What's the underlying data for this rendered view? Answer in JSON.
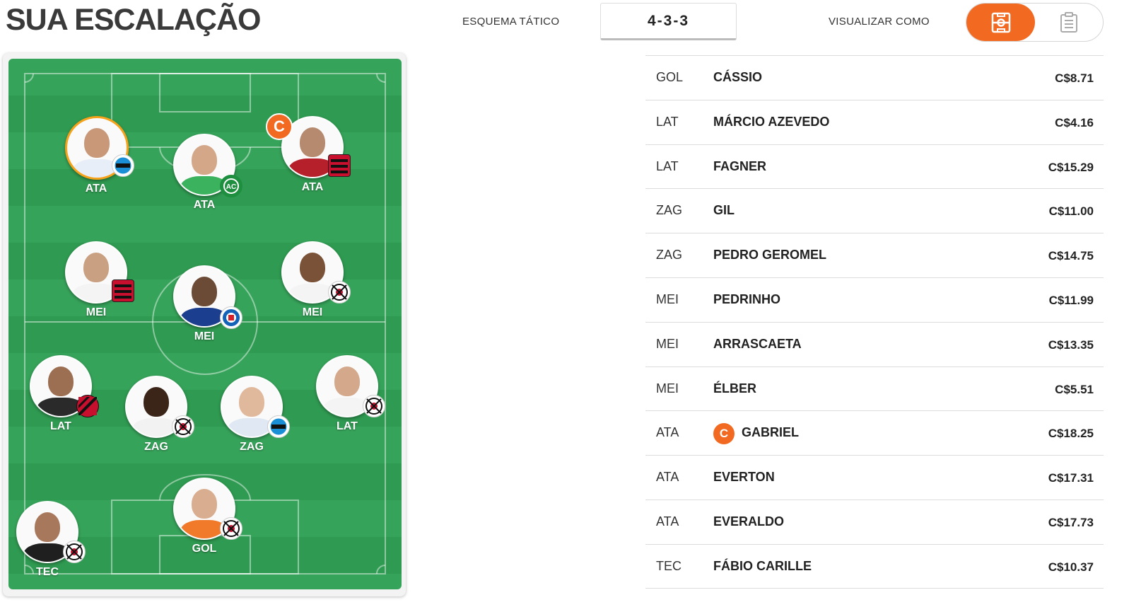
{
  "header": {
    "title": "SUA ESCALAÇÃO",
    "scheme_label": "ESQUEMA TÁTICO",
    "scheme_value": "4-3-3",
    "view_label": "VISUALIZAR COMO",
    "view_options": [
      "field-view-icon",
      "list-view-icon"
    ],
    "view_selected": "field-view-icon"
  },
  "colors": {
    "accent": "#f26a22",
    "captain_ring": "#f7a21b",
    "field_light": "#36a35a",
    "field_dark": "#2f9a51"
  },
  "field": {
    "players": [
      {
        "pos": "ATA",
        "club_icon": "gremio-crest-icon",
        "captain_ring": true
      },
      {
        "pos": "ATA",
        "club_icon": "chapecoense-crest-icon"
      },
      {
        "pos": "ATA",
        "club_icon": "flamengo-crest-icon",
        "captain": true
      },
      {
        "pos": "MEI",
        "club_icon": "flamengo-crest-icon"
      },
      {
        "pos": "MEI",
        "club_icon": "bahia-crest-icon"
      },
      {
        "pos": "MEI",
        "club_icon": "corinthians-crest-icon"
      },
      {
        "pos": "LAT",
        "club_icon": "athletico-crest-icon"
      },
      {
        "pos": "ZAG",
        "club_icon": "corinthians-crest-icon"
      },
      {
        "pos": "ZAG",
        "club_icon": "gremio-crest-icon"
      },
      {
        "pos": "LAT",
        "club_icon": "corinthians-crest-icon"
      },
      {
        "pos": "GOL",
        "club_icon": "corinthians-crest-icon"
      },
      {
        "pos": "TEC",
        "club_icon": "corinthians-crest-icon"
      }
    ],
    "captain_letter": "C"
  },
  "list": {
    "rows": [
      {
        "pos": "GOL",
        "name": "CÁSSIO",
        "price": "C$8.71"
      },
      {
        "pos": "LAT",
        "name": "MÁRCIO AZEVEDO",
        "price": "C$4.16"
      },
      {
        "pos": "LAT",
        "name": "FAGNER",
        "price": "C$15.29"
      },
      {
        "pos": "ZAG",
        "name": "GIL",
        "price": "C$11.00"
      },
      {
        "pos": "ZAG",
        "name": "PEDRO GEROMEL",
        "price": "C$14.75"
      },
      {
        "pos": "MEI",
        "name": "PEDRINHO",
        "price": "C$11.99"
      },
      {
        "pos": "MEI",
        "name": "ARRASCAETA",
        "price": "C$13.35"
      },
      {
        "pos": "MEI",
        "name": "ÉLBER",
        "price": "C$5.51"
      },
      {
        "pos": "ATA",
        "name": "GABRIEL",
        "price": "C$18.25",
        "captain": "C"
      },
      {
        "pos": "ATA",
        "name": "EVERTON",
        "price": "C$17.31"
      },
      {
        "pos": "ATA",
        "name": "EVERALDO",
        "price": "C$17.73"
      },
      {
        "pos": "TEC",
        "name": "FÁBIO CARILLE",
        "price": "C$10.37"
      }
    ]
  }
}
